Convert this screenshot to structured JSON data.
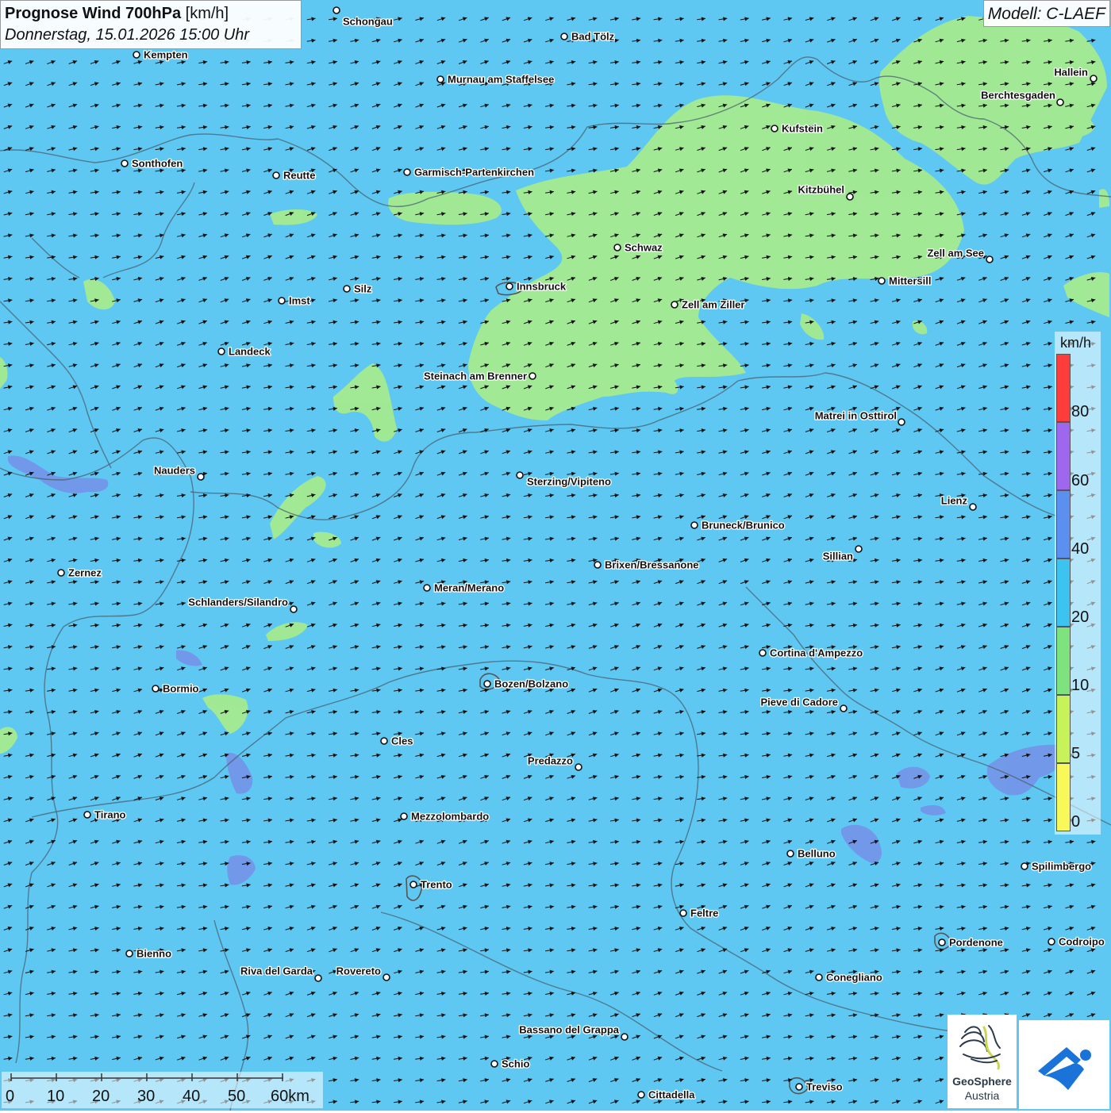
{
  "header": {
    "title_bold": "Prognose Wind 700hPa",
    "title_unit": " [km/h]",
    "datetime": "Donnerstag, 15.01.2026 15:00 Uhr",
    "model": "Modell: C-LAEF"
  },
  "legend": {
    "unit": "km/h",
    "labels": [
      "80",
      "60",
      "40",
      "20",
      "10",
      "5",
      "0"
    ],
    "colors": [
      "#ff3c3c",
      "#9f66ee",
      "#5b8ff0",
      "#3cc3f0",
      "#7ee27e",
      "#c8f25a",
      "#f8f85a"
    ]
  },
  "scalebar": {
    "labels": [
      "0",
      "10",
      "20",
      "30",
      "40",
      "50",
      "60km"
    ]
  },
  "logos": {
    "geosphere_line1": "GeoSphere",
    "geosphere_line2": "Austria"
  },
  "colors": {
    "sea_background": "#5ec8f2",
    "low_wind_green": "#a8ec8a",
    "higher_wind_purple": "#7a8ae6"
  },
  "cities": [
    {
      "name": "Schongau"
    },
    {
      "name": "Bad Tölz"
    },
    {
      "name": "Kempten"
    },
    {
      "name": "Murnau am Staffelsee"
    },
    {
      "name": "Hallein"
    },
    {
      "name": "Berchtesgaden"
    },
    {
      "name": "Kufstein"
    },
    {
      "name": "Sonthofen"
    },
    {
      "name": "Reutte"
    },
    {
      "name": "Garmisch-Partenkirchen"
    },
    {
      "name": "Kitzbühel"
    },
    {
      "name": "Schwaz"
    },
    {
      "name": "Zell am See"
    },
    {
      "name": "Mittersill"
    },
    {
      "name": "Innsbruck"
    },
    {
      "name": "Silz"
    },
    {
      "name": "Imst"
    },
    {
      "name": "Zell am Ziller"
    },
    {
      "name": "Landeck"
    },
    {
      "name": "Steinach am Brenner"
    },
    {
      "name": "Matrei in Osttirol"
    },
    {
      "name": "Nauders"
    },
    {
      "name": "Sterzing/Vipiteno"
    },
    {
      "name": "Lienz"
    },
    {
      "name": "Bruneck/Brunico"
    },
    {
      "name": "Sillian"
    },
    {
      "name": "Zernez"
    },
    {
      "name": "Brixen/Bressanone"
    },
    {
      "name": "Meran/Merano"
    },
    {
      "name": "Schlanders/Silandro"
    },
    {
      "name": "Cortina d'Ampezzo"
    },
    {
      "name": "Bozen/Bolzano"
    },
    {
      "name": "Bormio"
    },
    {
      "name": "Pieve di Cadore"
    },
    {
      "name": "Cles"
    },
    {
      "name": "Predazzo"
    },
    {
      "name": "Tirano"
    },
    {
      "name": "Mezzolombardo"
    },
    {
      "name": "Belluno"
    },
    {
      "name": "Spilimbergo"
    },
    {
      "name": "Trento"
    },
    {
      "name": "Feltre"
    },
    {
      "name": "Pordenone"
    },
    {
      "name": "Codroipo"
    },
    {
      "name": "Bienno"
    },
    {
      "name": "Riva del Garda"
    },
    {
      "name": "Rovereto"
    },
    {
      "name": "Conegliano"
    },
    {
      "name": "Bassano del Grappa"
    },
    {
      "name": "Schio"
    },
    {
      "name": "Treviso"
    },
    {
      "name": "Cittadella"
    }
  ]
}
